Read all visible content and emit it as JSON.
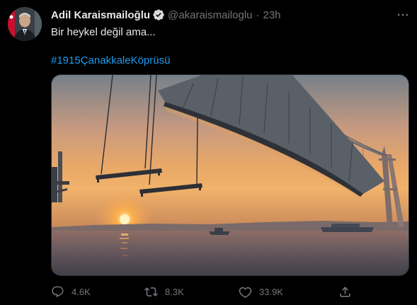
{
  "tweet": {
    "display_name": "Adil Karaismailoğlu",
    "handle": "@akaraismailoglu",
    "separator": "·",
    "time": "23h",
    "text": "Bir heykel değil ama...",
    "hashtag": "#1915ÇanakkaleKöprüsü",
    "verified_icon": "verified-badge-icon",
    "more_icon": "more-options-icon"
  },
  "actions": {
    "reply": {
      "icon": "reply-icon",
      "count": "4.6K"
    },
    "retweet": {
      "icon": "retweet-icon",
      "count": "8.3K"
    },
    "like": {
      "icon": "like-icon",
      "count": "33.9K"
    },
    "share": {
      "icon": "share-icon"
    }
  },
  "colors": {
    "background": "#000000",
    "text": "#e7e9ea",
    "secondary": "#71767b",
    "link": "#1d9bf0",
    "verified": "#d9d9d9"
  }
}
